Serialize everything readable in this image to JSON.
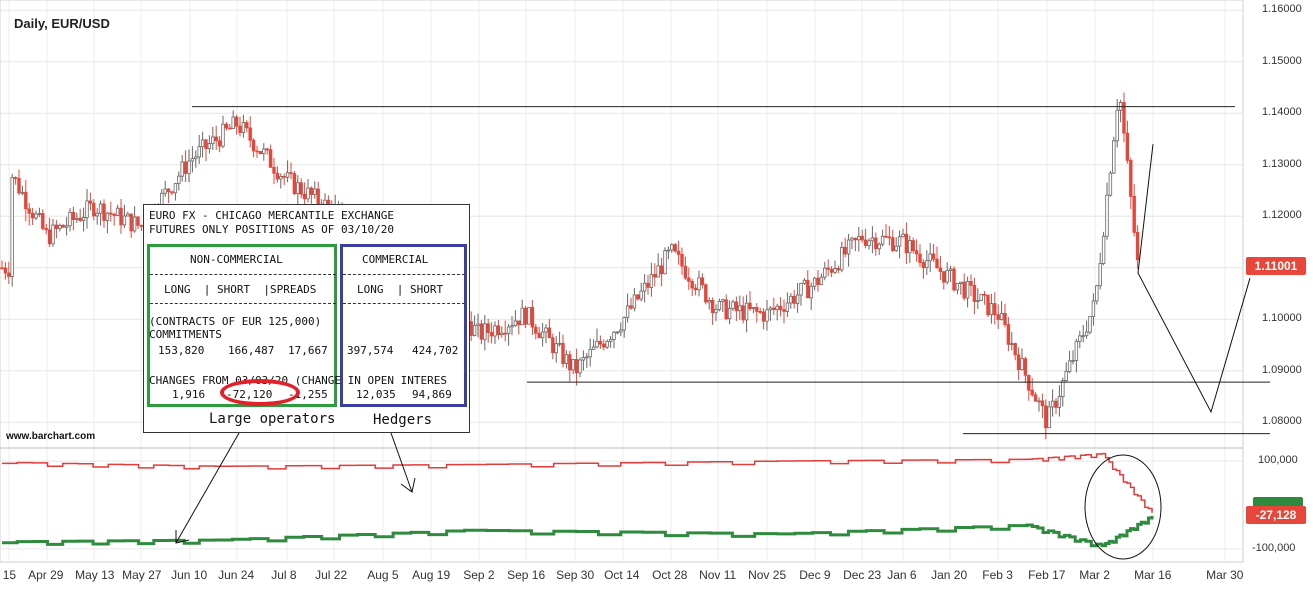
{
  "header": {
    "title": "Daily, EUR/USD",
    "watermark": "www.barchart.com"
  },
  "cot_table": {
    "line1": "EURO FX - CHICAGO MERCANTILE EXCHANGE",
    "line2": "FUTURES ONLY POSITIONS AS OF 03/10/20",
    "noncommercial_header": "NON-COMMERCIAL",
    "commercial_header": "COMMERCIAL",
    "col_headers_nc": "LONG  | SHORT  |SPREADS",
    "col_headers_c": "LONG  | SHORT",
    "contracts_note": "(CONTRACTS OF EUR 125,000)",
    "commitments_label": "COMMITMENTS",
    "commit_nc_long": "153,820",
    "commit_nc_short": "166,487",
    "commit_nc_spreads": "17,667",
    "commit_c_long": "397,574",
    "commit_c_short": "424,702",
    "changes_label": "CHANGES FROM 03/03/20 (CHANGE IN OPEN INTERES",
    "chg_nc_long": "1,916",
    "chg_nc_short": "-72,120",
    "chg_nc_spreads": "-1,255",
    "chg_c_long": "12,035",
    "chg_c_short": "94,869"
  },
  "annotations": {
    "large_operators": "Large operators",
    "hedgers": "Hedgers"
  },
  "price_tag": "1.11001",
  "indicator_tag": "-27,128",
  "colors": {
    "up": "#666666",
    "down": "#e6473a",
    "noncommercial_line": "#e23b3b",
    "commercial_line": "#2e8b3e",
    "tag": "#e6473a"
  },
  "chart_data": [
    {
      "type": "candlestick",
      "title": "Daily, EUR/USD",
      "y_ticks": [
        "1.16000",
        "1.15000",
        "1.14000",
        "1.13000",
        "1.12000",
        "1.11000",
        "1.10000",
        "1.09000",
        "1.08000"
      ],
      "ylim": [
        1.075,
        1.162
      ],
      "x_ticks": [
        "15",
        "Apr 29",
        "May 13",
        "May 27",
        "Jun 10",
        "Jun 24",
        "Jul 8",
        "Jul 22",
        "Aug 5",
        "Aug 19",
        "Sep 2",
        "Sep 16",
        "Sep 30",
        "Oct 14",
        "Oct 28",
        "Nov 11",
        "Nov 25",
        "Dec 9",
        "Dec 23",
        "Jan 6",
        "Jan 20",
        "Feb 3",
        "Feb 17",
        "Mar 2",
        "Mar 16",
        "Mar 30"
      ],
      "close_path": [
        [
          "Apr 15",
          1.129
        ],
        [
          "Apr 29",
          1.116
        ],
        [
          "May 13",
          1.122
        ],
        [
          "May 27",
          1.118
        ],
        [
          "Jun 10",
          1.131
        ],
        [
          "Jun 24",
          1.138
        ],
        [
          "Jul 8",
          1.127
        ],
        [
          "Jul 22",
          1.121
        ],
        [
          "Aug 5",
          1.115
        ],
        [
          "Aug 19",
          1.108
        ],
        [
          "Sep 2",
          1.097
        ],
        [
          "Sep 16",
          1.101
        ],
        [
          "Sep 30",
          1.09
        ],
        [
          "Oct 14",
          1.1
        ],
        [
          "Oct 28",
          1.113
        ],
        [
          "Nov 11",
          1.102
        ],
        [
          "Nov 25",
          1.101
        ],
        [
          "Dec 9",
          1.107
        ],
        [
          "Dec 23",
          1.116
        ],
        [
          "Jan 6",
          1.115
        ],
        [
          "Jan 20",
          1.108
        ],
        [
          "Feb 3",
          1.101
        ],
        [
          "Feb 17",
          1.08
        ],
        [
          "Mar 2",
          1.103
        ],
        [
          "Mar 9",
          1.145
        ],
        [
          "Mar 13",
          1.11
        ]
      ],
      "last": 1.11001,
      "horizontal_lines": [
        1.1413,
        1.0878,
        1.0778
      ],
      "projection": [
        [
          "Mar 13",
          1.109
        ],
        [
          "Mar 16",
          1.134
        ],
        [
          "Mar 13",
          1.109
        ],
        [
          "Mar 28",
          1.082
        ],
        [
          "Apr 5",
          1.108
        ]
      ]
    },
    {
      "type": "line",
      "y_ticks": [
        "100,000",
        "-100,000"
      ],
      "ylim": [
        -130000,
        130000
      ],
      "series": [
        {
          "name": "Non-Commercial",
          "values": [
            [
              0,
              95000
            ],
            [
              0.17,
              86000
            ],
            [
              0.37,
              90000
            ],
            [
              0.62,
              98000
            ],
            [
              0.82,
              102000
            ],
            [
              0.88,
              115000
            ],
            [
              0.92,
              -20000
            ]
          ]
        },
        {
          "name": "Commercial",
          "values": [
            [
              0,
              -86000
            ],
            [
              0.17,
              -82000
            ],
            [
              0.37,
              -60000
            ],
            [
              0.62,
              -68000
            ],
            [
              0.82,
              -48000
            ],
            [
              0.88,
              -95000
            ],
            [
              0.92,
              -27128
            ]
          ]
        }
      ],
      "last": -27128
    }
  ]
}
